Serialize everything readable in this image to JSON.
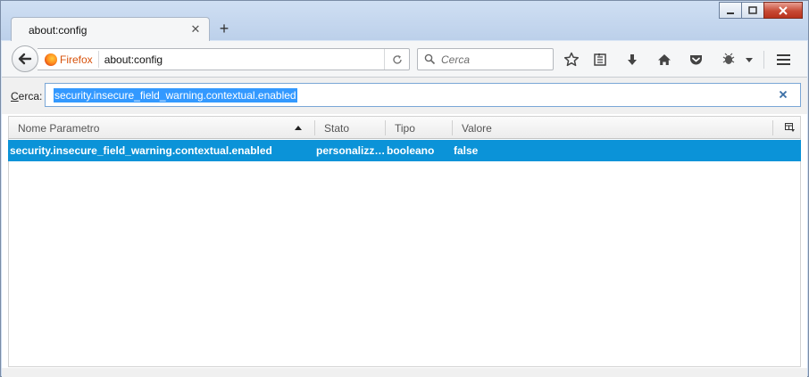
{
  "window": {
    "controls": [
      "minimize",
      "maximize",
      "close"
    ]
  },
  "tabs": [
    {
      "title": "about:config",
      "close_icon": "close-icon"
    }
  ],
  "new_tab_label": "+",
  "navbar": {
    "identity_label": "Firefox",
    "url": "about:config",
    "search_placeholder": "Cerca"
  },
  "filter": {
    "label_prefix": "",
    "label_accesskey": "C",
    "label_rest": "erca:",
    "value": "security.insecure_field_warning.contextual.enabled"
  },
  "columns": [
    "Nome Parametro",
    "Stato",
    "Tipo",
    "Valore"
  ],
  "rows": [
    {
      "name": "security.insecure_field_warning.contextual.enabled",
      "status": "personalizz…",
      "type": "booleano",
      "value": "false"
    }
  ],
  "colors": {
    "selection": "#0b93d8",
    "identity": "#d7520b",
    "close_button": "#c74a35"
  }
}
